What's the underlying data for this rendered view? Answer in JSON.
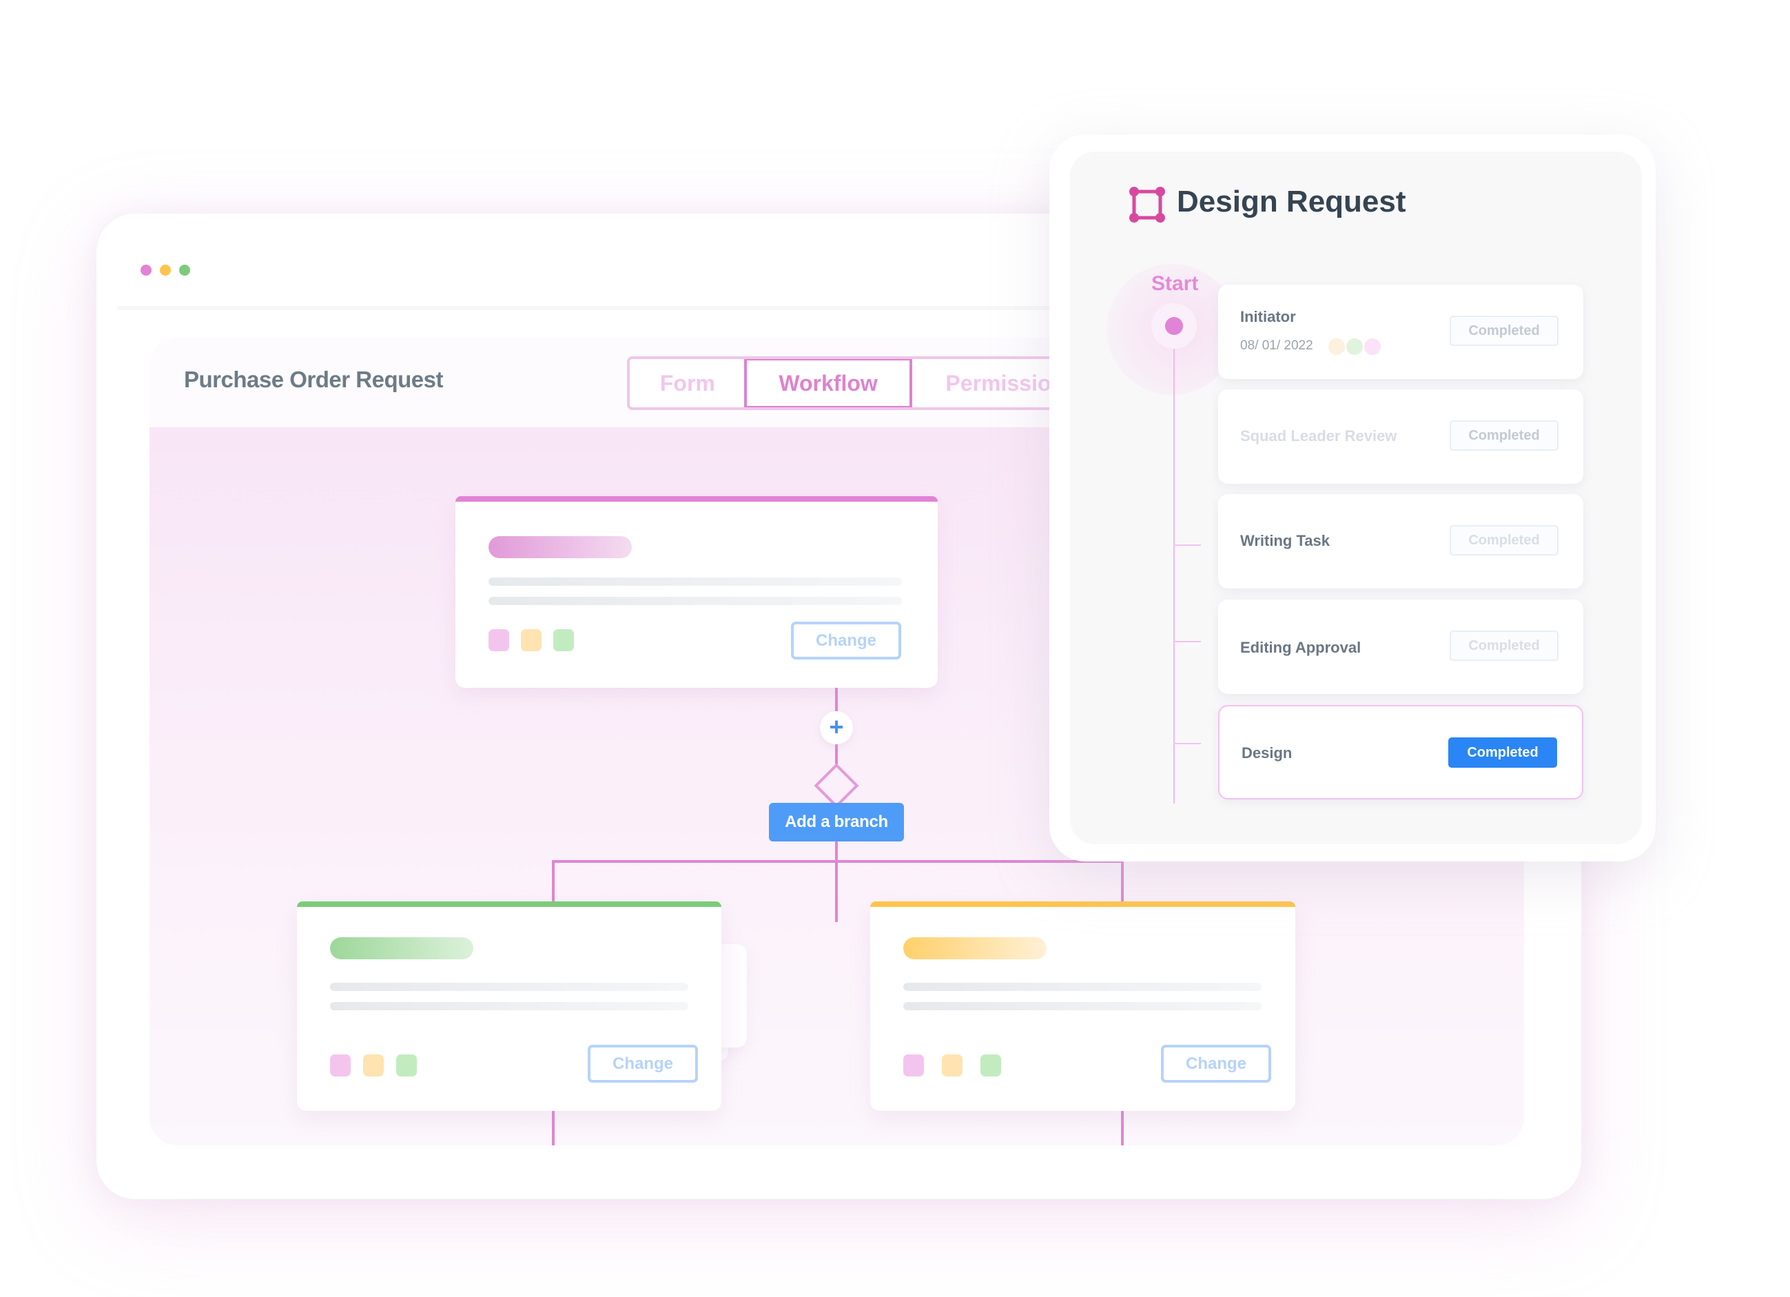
{
  "window": {
    "traffic_lights": [
      "#e183d6",
      "#ffc44d",
      "#7dcb7a"
    ],
    "page_title": "Purchase Order Request",
    "tabs": [
      {
        "label": "Form",
        "active": false
      },
      {
        "label": "Workflow",
        "active": true
      },
      {
        "label": "Permission",
        "active": false
      }
    ]
  },
  "workflow": {
    "accent": "#de86d4",
    "top_card": {
      "accent": "#e183d6",
      "change_label": "Change",
      "swatches": [
        "#f3c5ee",
        "#ffe3b0",
        "#c2ecc0"
      ]
    },
    "plus_label": "+",
    "add_branch_label": "Add a branch",
    "branches": [
      {
        "accent": "#7dcb7a",
        "change_label": "Change",
        "swatches": [
          "#f3c5ee",
          "#ffe3b0",
          "#c2ecc0"
        ]
      },
      {
        "accent": "#ffc44d",
        "change_label": "Change",
        "swatches": [
          "#f3c5ee",
          "#ffe3b0",
          "#c2ecc0"
        ]
      }
    ]
  },
  "design_request": {
    "title": "Design Request",
    "start_label": "Start",
    "steps": [
      {
        "label": "Initiator",
        "date": "08/ 01/ 2022",
        "status": "Completed",
        "avatars": [
          "#fdf0dc",
          "#dff3dd",
          "#fbe2f7"
        ]
      },
      {
        "label": "Squad Leader Review",
        "status": "Completed"
      },
      {
        "label": "Writing Task",
        "status": "Completed"
      },
      {
        "label": "Editing Approval",
        "status": "Completed"
      },
      {
        "label": "Design",
        "status": "Completed",
        "active": true
      }
    ]
  }
}
